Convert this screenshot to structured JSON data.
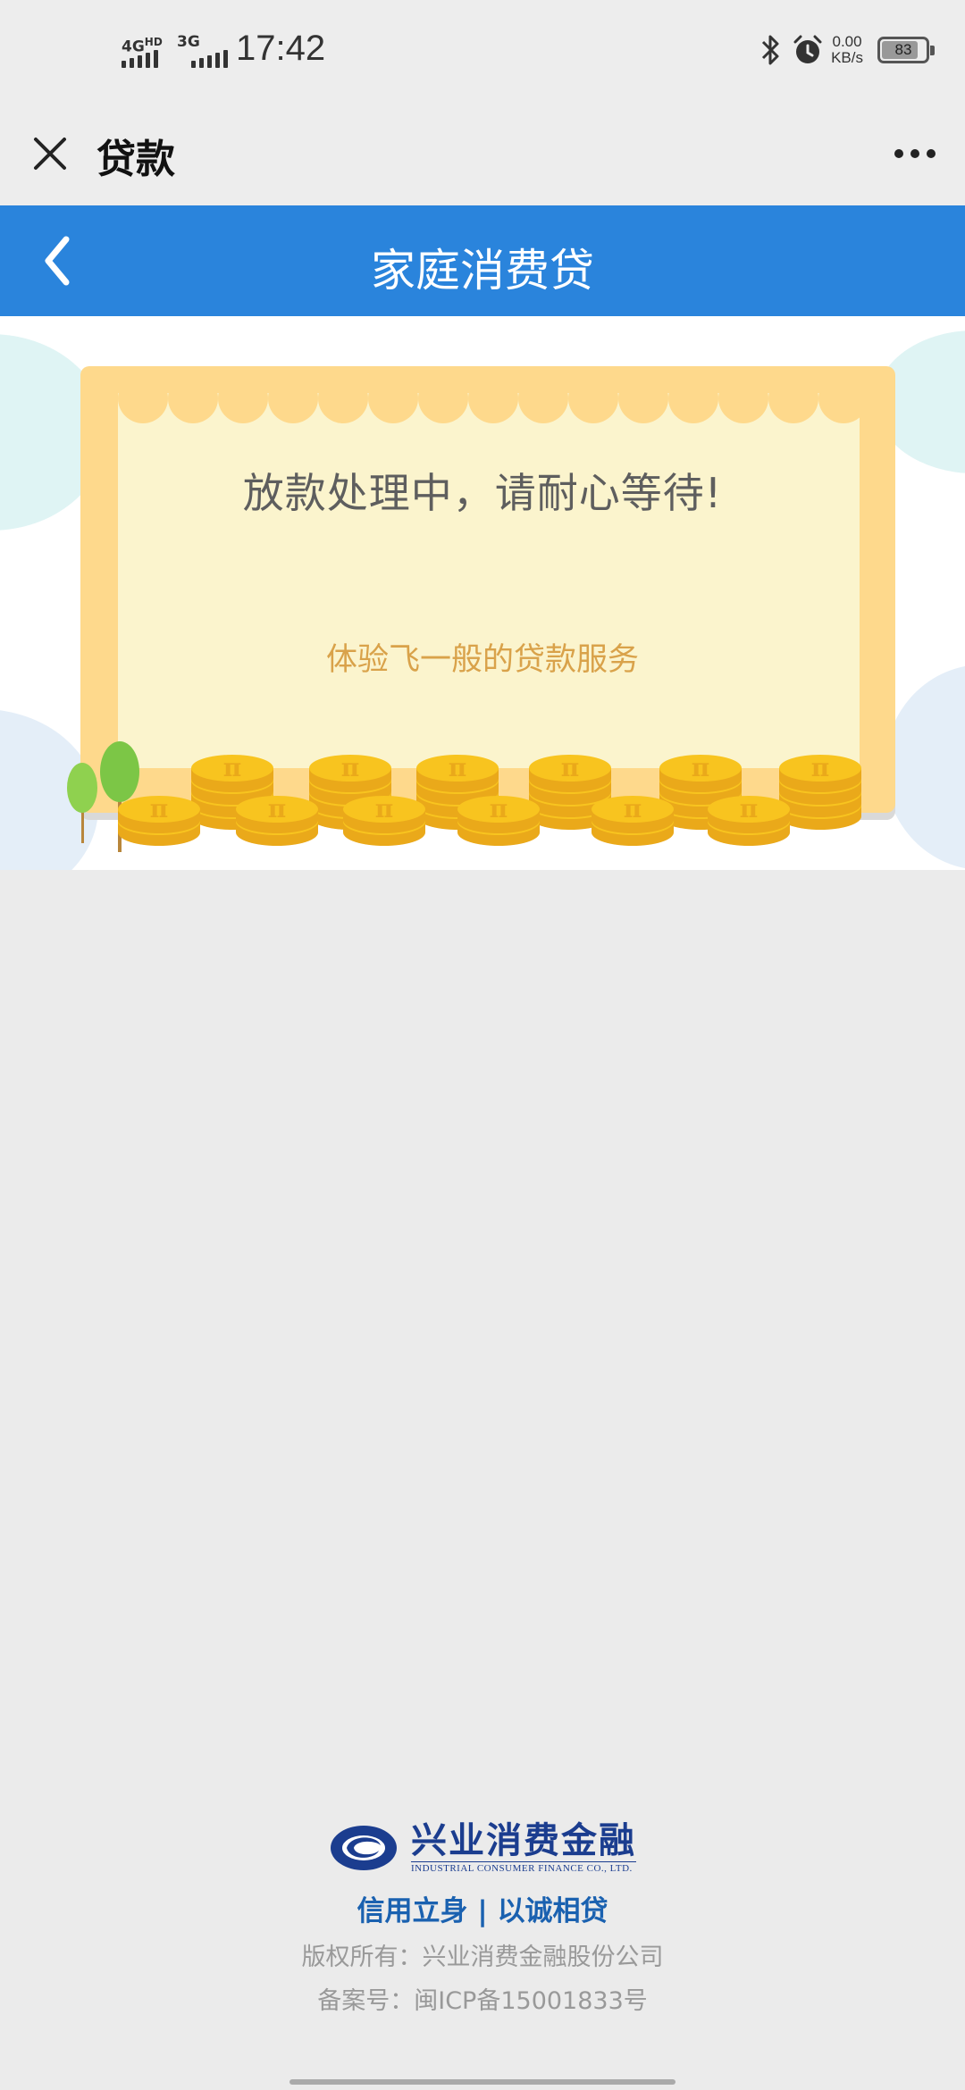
{
  "status_bar": {
    "net1": "4G",
    "net1_badge": "HD",
    "net2": "3G",
    "time": "17:42",
    "speed_value": "0.00",
    "speed_unit": "KB/s",
    "battery": "83",
    "battery_level": 0.83
  },
  "webview": {
    "title": "贷款"
  },
  "nav": {
    "title": "家庭消费贷"
  },
  "status_card": {
    "message": "放款处理中，请耐心等待!",
    "slogan": "体验飞一般的贷款服务",
    "coin_symbol": "π"
  },
  "footer": {
    "logo_name": "兴业消费金融",
    "logo_en": "INDUSTRIAL CONSUMER FINANCE CO., LTD.",
    "slogan": "信用立身 | 以诚相贷",
    "copyright": "版权所有：兴业消费金融股份公司",
    "icp": "备案号：闽ICP备15001833号"
  },
  "colors": {
    "nav_blue": "#2a84dc",
    "card_border": "#fed98c",
    "card_inner": "#fbf4cd",
    "coin": "#f8c41f",
    "slogan_orange": "#d9a24a",
    "brand_blue": "#1b3d8f"
  }
}
